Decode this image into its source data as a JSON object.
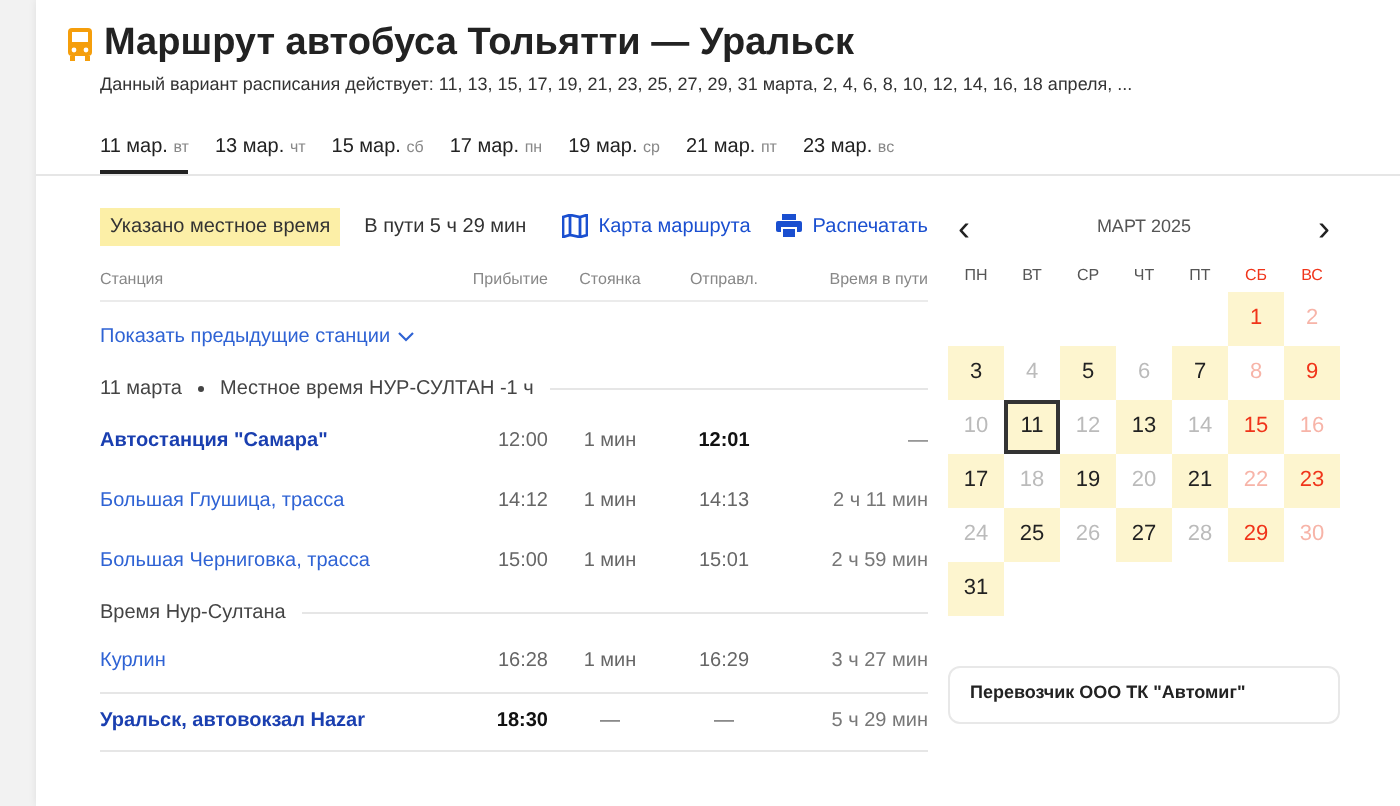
{
  "header": {
    "title": "Маршрут автобуса Тольятти — Уральск",
    "subtitle": "Данный вариант расписания действует: 11, 13, 15, 17, 19, 21, 23, 25, 27, 29, 31 марта, 2, 4, 6, 8, 10, 12, 14, 16, 18 апреля, ..."
  },
  "date_tabs": [
    {
      "date": "11 мар.",
      "weekday": "вт",
      "selected": true
    },
    {
      "date": "13 мар.",
      "weekday": "чт",
      "selected": false
    },
    {
      "date": "15 мар.",
      "weekday": "сб",
      "selected": false
    },
    {
      "date": "17 мар.",
      "weekday": "пн",
      "selected": false
    },
    {
      "date": "19 мар.",
      "weekday": "ср",
      "selected": false
    },
    {
      "date": "21 мар.",
      "weekday": "пт",
      "selected": false
    },
    {
      "date": "23 мар.",
      "weekday": "вс",
      "selected": false
    }
  ],
  "info_bar": {
    "badge": "Указано местное время",
    "duration": "В пути 5 ч 29 мин",
    "map_link": "Карта маршрута",
    "print_link": "Распечатать"
  },
  "table": {
    "columns": [
      "Станция",
      "Прибытие",
      "Стоянка",
      "Отправл.",
      "Время в пути"
    ],
    "show_previous": "Показать предыдущие станции",
    "rows": [
      {
        "kind": "group",
        "date": "11 марта",
        "text": "Местное время НУР-СУЛТАН -1 ч"
      },
      {
        "kind": "origin",
        "station": "Автостанция \"Самара\"",
        "arrival": "12:00",
        "stop": "1 мин",
        "departure": "12:01",
        "travel": "—"
      },
      {
        "kind": "stop",
        "station": "Большая Глушица, трасса",
        "arrival": "14:12",
        "stop": "1 мин",
        "departure": "14:13",
        "travel": "2 ч 11 мин"
      },
      {
        "kind": "stop",
        "station": "Большая Черниговка, трасса",
        "arrival": "15:00",
        "stop": "1 мин",
        "departure": "15:01",
        "travel": "2 ч 59 мин"
      },
      {
        "kind": "zone",
        "text": "Время Нур-Султана"
      },
      {
        "kind": "stop",
        "station": "Курлин",
        "arrival": "16:28",
        "stop": "1 мин",
        "departure": "16:29",
        "travel": "3 ч 27 мин"
      },
      {
        "kind": "destination",
        "station": "Уральск, автовокзал Hazar",
        "arrival": "18:30",
        "stop": "—",
        "departure": "—",
        "travel": "5 ч 29 мин"
      }
    ]
  },
  "calendar": {
    "prev": "‹",
    "next": "›",
    "month": "МАРТ 2025",
    "weekdays": [
      {
        "label": "ПН",
        "weekend": false
      },
      {
        "label": "ВТ",
        "weekend": false
      },
      {
        "label": "СР",
        "weekend": false
      },
      {
        "label": "ЧТ",
        "weekend": false
      },
      {
        "label": "ПТ",
        "weekend": false
      },
      {
        "label": "СБ",
        "weekend": true
      },
      {
        "label": "ВС",
        "weekend": true
      }
    ],
    "weeks": [
      {
        "kind": "first",
        "days": [
          {
            "day": "1",
            "available": true,
            "selected": false
          },
          {
            "day": "2",
            "available": false,
            "selected": false
          }
        ]
      },
      {
        "kind": "full",
        "days": [
          {
            "day": "3",
            "available": true,
            "selected": false
          },
          {
            "day": "4",
            "available": false,
            "selected": false
          },
          {
            "day": "5",
            "available": true,
            "selected": false
          },
          {
            "day": "6",
            "available": false,
            "selected": false
          },
          {
            "day": "7",
            "available": true,
            "selected": false
          },
          {
            "day": "8",
            "available": false,
            "selected": false
          },
          {
            "day": "9",
            "available": true,
            "selected": false
          }
        ]
      },
      {
        "kind": "full",
        "days": [
          {
            "day": "10",
            "available": false,
            "selected": false
          },
          {
            "day": "11",
            "available": true,
            "selected": true
          },
          {
            "day": "12",
            "available": false,
            "selected": false
          },
          {
            "day": "13",
            "available": true,
            "selected": false
          },
          {
            "day": "14",
            "available": false,
            "selected": false
          },
          {
            "day": "15",
            "available": true,
            "selected": false
          },
          {
            "day": "16",
            "available": false,
            "selected": false
          }
        ]
      },
      {
        "kind": "full",
        "days": [
          {
            "day": "17",
            "available": true,
            "selected": false
          },
          {
            "day": "18",
            "available": false,
            "selected": false
          },
          {
            "day": "19",
            "available": true,
            "selected": false
          },
          {
            "day": "20",
            "available": false,
            "selected": false
          },
          {
            "day": "21",
            "available": true,
            "selected": false
          },
          {
            "day": "22",
            "available": false,
            "selected": false
          },
          {
            "day": "23",
            "available": true,
            "selected": false
          }
        ]
      },
      {
        "kind": "full",
        "days": [
          {
            "day": "24",
            "available": false,
            "selected": false
          },
          {
            "day": "25",
            "available": true,
            "selected": false
          },
          {
            "day": "26",
            "available": false,
            "selected": false
          },
          {
            "day": "27",
            "available": true,
            "selected": false
          },
          {
            "day": "28",
            "available": false,
            "selected": false
          },
          {
            "day": "29",
            "available": true,
            "selected": false
          },
          {
            "day": "30",
            "available": false,
            "selected": false
          }
        ]
      },
      {
        "kind": "last",
        "days": [
          {
            "day": "31",
            "available": true,
            "selected": false
          }
        ]
      }
    ]
  },
  "carrier": "Перевозчик ООО ТК \"Автомиг\""
}
